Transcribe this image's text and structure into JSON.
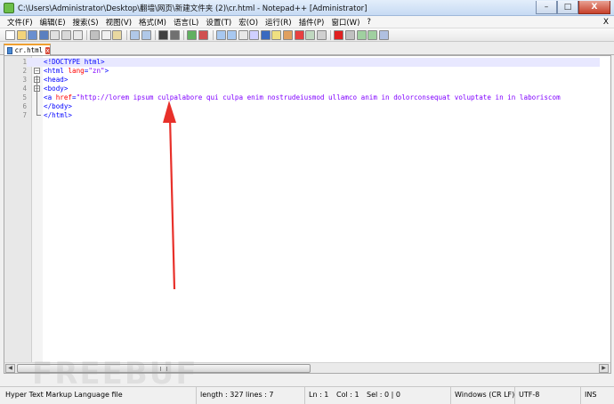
{
  "window": {
    "title": "C:\\Users\\Administrator\\Desktop\\翻墙\\网页\\新建文件夹 (2)\\cr.html - Notepad++ [Administrator]",
    "minimize": "–",
    "maximize": "□",
    "close": "X"
  },
  "menu": {
    "items": [
      "文件(F)",
      "编辑(E)",
      "搜索(S)",
      "视图(V)",
      "格式(M)",
      "语言(L)",
      "设置(T)",
      "宏(O)",
      "运行(R)",
      "插件(P)",
      "窗口(W)",
      "?"
    ],
    "close": "X"
  },
  "tab": {
    "label": "cr.html",
    "close": "x"
  },
  "editor": {
    "lines": [
      {
        "num": "1",
        "text": "<!DOCTYPE html>"
      },
      {
        "num": "2",
        "pre": "<html ",
        "attr": "lang",
        "eq": "=",
        "val": "\"zn\"",
        "post": ">"
      },
      {
        "num": "3",
        "text": "<head>"
      },
      {
        "num": "4",
        "text": "<body>"
      },
      {
        "num": "5",
        "pre": "<a ",
        "attr": "href",
        "eq": "=",
        "val": "\"http://lorem ipsum culpalabore qui culpa enim nostrudeiusmod ullamco anim in dolorconsequat voluptate in in laboriscom"
      },
      {
        "num": "6",
        "text": "</body>"
      },
      {
        "num": "7",
        "text": "</html>"
      }
    ]
  },
  "watermark": "FREEBUF",
  "status": {
    "language": "Hyper Text Markup Language file",
    "length": "length : 327",
    "lines": "lines : 7",
    "ln": "Ln : 1",
    "col": "Col : 1",
    "sel": "Sel : 0 | 0",
    "eol": "Windows (CR LF)",
    "encoding": "UTF-8",
    "mode": "INS"
  },
  "colors": {
    "tag": "#0000ff",
    "attr": "#ff0000",
    "value": "#8000ff",
    "arrow": "#e8302a",
    "tab_accent": "#f0a030"
  }
}
